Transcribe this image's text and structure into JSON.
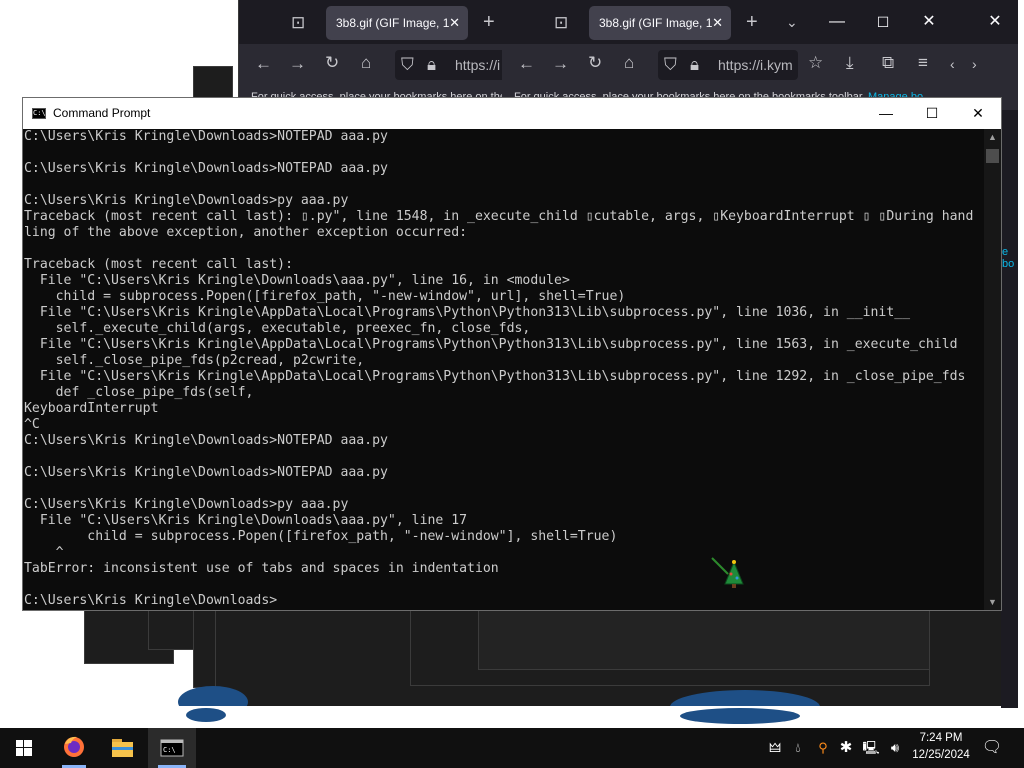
{
  "browser_back": {
    "tab_title": "3b8.gif (GIF Image, 1",
    "url": "https://i",
    "bookmarks_text": "For quick access, place your bookmarks here on the bookmarks toolbar."
  },
  "browser_front": {
    "tab_title": "3b8.gif (GIF Image, 1",
    "url": "https://i.kym",
    "bookmarks_text": "For quick access, place your bookmarks here on the bookmarks toolbar.",
    "bookmarks_link": "Manage bo"
  },
  "right_edge_link": "e bo",
  "cmd": {
    "title": "Command Prompt",
    "lines": [
      "C:\\Users\\Kris Kringle\\Downloads>NOTEPAD aaa.py",
      "",
      "C:\\Users\\Kris Kringle\\Downloads>NOTEPAD aaa.py",
      "",
      "C:\\Users\\Kris Kringle\\Downloads>py aaa.py",
      "Traceback (most recent call last): ▯.py\", line 1548, in _execute_child ▯cutable, args, ▯KeyboardInterrupt ▯ ▯During hand",
      "ling of the above exception, another exception occurred:",
      "",
      "Traceback (most recent call last):",
      "  File \"C:\\Users\\Kris Kringle\\Downloads\\aaa.py\", line 16, in <module>",
      "    child = subprocess.Popen([firefox_path, \"-new-window\", url], shell=True)",
      "  File \"C:\\Users\\Kris Kringle\\AppData\\Local\\Programs\\Python\\Python313\\Lib\\subprocess.py\", line 1036, in __init__",
      "    self._execute_child(args, executable, preexec_fn, close_fds,",
      "  File \"C:\\Users\\Kris Kringle\\AppData\\Local\\Programs\\Python\\Python313\\Lib\\subprocess.py\", line 1563, in _execute_child",
      "    self._close_pipe_fds(p2cread, p2cwrite,",
      "  File \"C:\\Users\\Kris Kringle\\AppData\\Local\\Programs\\Python\\Python313\\Lib\\subprocess.py\", line 1292, in _close_pipe_fds",
      "    def _close_pipe_fds(self,",
      "KeyboardInterrupt",
      "^C",
      "C:\\Users\\Kris Kringle\\Downloads>NOTEPAD aaa.py",
      "",
      "C:\\Users\\Kris Kringle\\Downloads>NOTEPAD aaa.py",
      "",
      "C:\\Users\\Kris Kringle\\Downloads>py aaa.py",
      "  File \"C:\\Users\\Kris Kringle\\Downloads\\aaa.py\", line 17",
      "        child = subprocess.Popen([firefox_path, \"-new-window\"], shell=True)",
      "    ^",
      "TabError: inconsistent use of tabs and spaces in indentation",
      "",
      "C:\\Users\\Kris Kringle\\Downloads>"
    ]
  },
  "taskbar": {
    "time": "7:24 PM",
    "date": "12/25/2024"
  },
  "colors": {
    "terminal_bg": "#0c0c0c",
    "terminal_fg": "#cccccc",
    "firefox_dark": "#1c1b22",
    "firefox_tab": "#42414d",
    "taskbar": "#101010",
    "firefox_orange": "#ff7139",
    "folder_yellow": "#f5c24b"
  },
  "icons": [
    "windows-logo-icon",
    "firefox-icon",
    "file-explorer-icon",
    "terminal-icon",
    "tray-app-icon",
    "droplet-icon",
    "search-app-icon",
    "bluetooth-icon",
    "network-icon",
    "volume-icon",
    "notification-icon"
  ]
}
